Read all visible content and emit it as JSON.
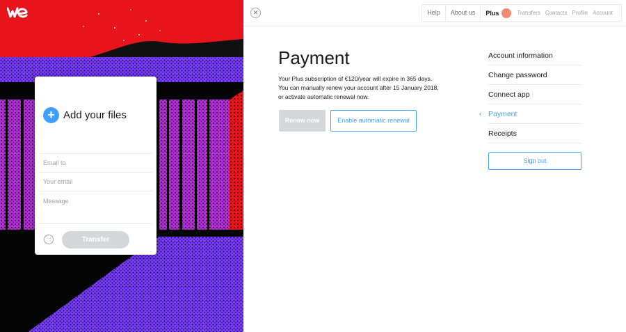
{
  "brand": {
    "logo_text": "we"
  },
  "upload_card": {
    "add_label": "Add your files",
    "email_to": "Email to",
    "your_email": "Your email",
    "message": "Message",
    "options_icon": "ellipsis-icon",
    "transfer_label": "Transfer"
  },
  "topbar": {
    "close_icon": "close-icon",
    "help": "Help",
    "about": "About us",
    "plus": "Plus",
    "transfers": "Transfers",
    "contacts": "Contacts",
    "profile": "Profile",
    "account": "Account"
  },
  "payment": {
    "title": "Payment",
    "line1": "Your Plus subscription of €120/year will expire in 365 days.",
    "line2": "You can manually renew your account after 15 January 2018,",
    "line3": "or activate automatic renewal now.",
    "renew_label": "Renew now",
    "auto_label": "Enable automatic renewal"
  },
  "account_menu": {
    "items": [
      {
        "label": "Account information"
      },
      {
        "label": "Change password"
      },
      {
        "label": "Connect app"
      },
      {
        "label": "Payment"
      },
      {
        "label": "Receipts"
      }
    ],
    "active_index": 3,
    "sign_out": "Sign out"
  },
  "colors": {
    "accent": "#409fff",
    "art_red": "#e8141c",
    "art_purple": "#7a3cff",
    "art_magenta": "#b02fd6"
  }
}
